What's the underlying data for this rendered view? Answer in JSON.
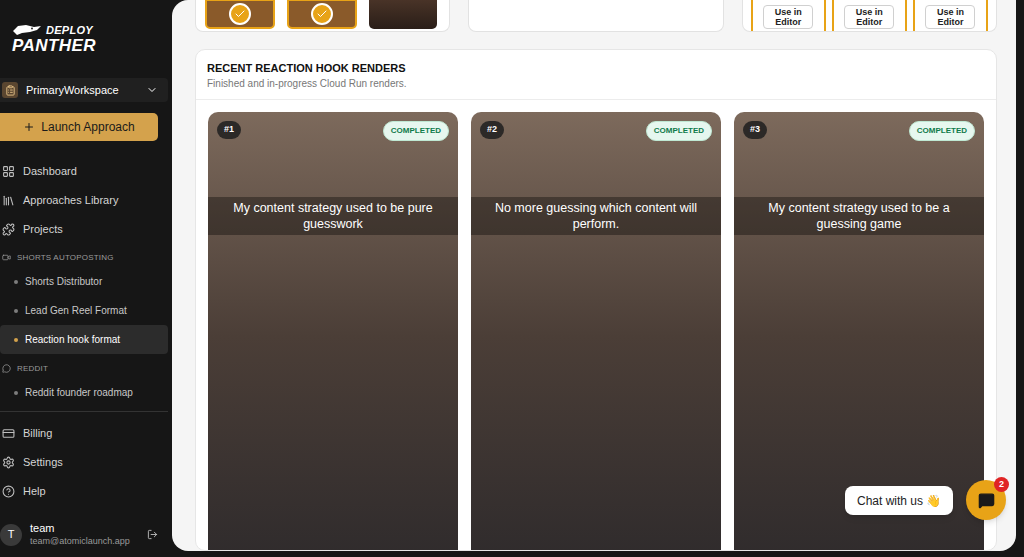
{
  "brand": {
    "top": "DEPLOY",
    "bottom": "PANTHER"
  },
  "workspace": {
    "name": "PrimaryWorkspace"
  },
  "launch_button": "Launch Approach",
  "nav": [
    {
      "label": "Dashboard",
      "selected": false
    },
    {
      "label": "Approaches Library",
      "selected": false
    },
    {
      "label": "Projects",
      "selected": false
    }
  ],
  "sections": [
    {
      "title": "SHORTS AUTOPOSTING",
      "items": [
        {
          "label": "Shorts Distributor",
          "selected": false
        },
        {
          "label": "Lead Gen Reel Format",
          "selected": false
        },
        {
          "label": "Reaction hook format",
          "selected": true
        }
      ]
    },
    {
      "title": "REDDIT",
      "items": [
        {
          "label": "Reddit founder roadmap",
          "selected": false
        }
      ]
    }
  ],
  "bottom_nav": [
    {
      "label": "Billing",
      "selected": false
    },
    {
      "label": "Settings",
      "selected": false
    },
    {
      "label": "Help",
      "selected": false
    }
  ],
  "user": {
    "avatar": "T",
    "name": "team",
    "email": "team@atomiclaunch.app"
  },
  "top_strip": {
    "thumbnails": [
      {
        "checked": true
      },
      {
        "checked": true
      },
      {
        "checked": false
      }
    ],
    "editor_buttons": [
      "Use in Editor",
      "Use in Editor",
      "Use in Editor"
    ]
  },
  "renders_panel": {
    "title": "RECENT REACTION HOOK RENDERS",
    "subtitle": "Finished and in-progress Cloud Run renders.",
    "renders": [
      {
        "index": "#1",
        "status": "COMPLETED",
        "caption": "My content strategy used to be pure guesswork"
      },
      {
        "index": "#2",
        "status": "COMPLETED",
        "caption": "No more guessing which content will perform."
      },
      {
        "index": "#3",
        "status": "COMPLETED",
        "caption": "My content strategy used to be a guessing game"
      }
    ]
  },
  "chat": {
    "label": "Chat with us 👋",
    "badge": "2"
  }
}
